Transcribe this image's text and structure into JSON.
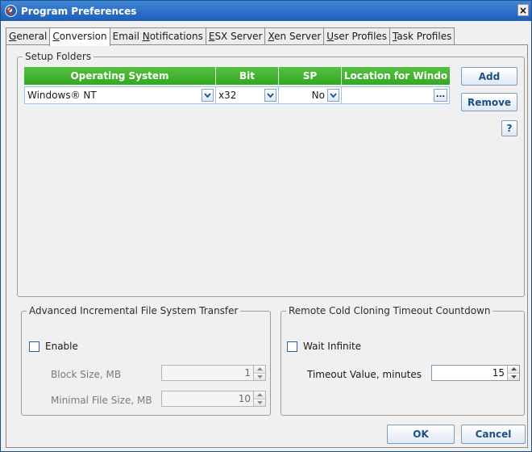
{
  "window": {
    "title": "Program Preferences",
    "close_glyph": "×"
  },
  "tabs": [
    {
      "pre": "",
      "u": "G",
      "post": "eneral",
      "active": false
    },
    {
      "pre": "",
      "u": "C",
      "post": "onversion",
      "active": true
    },
    {
      "pre": "Email ",
      "u": "N",
      "post": "otifications",
      "active": false
    },
    {
      "pre": "",
      "u": "E",
      "post": "SX Server",
      "active": false
    },
    {
      "pre": "",
      "u": "X",
      "post": "en Server",
      "active": false
    },
    {
      "pre": "",
      "u": "U",
      "post": "ser Profiles",
      "active": false
    },
    {
      "pre": "",
      "u": "T",
      "post": "ask Profiles",
      "active": false
    }
  ],
  "setup_folders": {
    "title": "Setup Folders",
    "columns": [
      "Operating System",
      "Bit",
      "SP",
      "Location for Windo"
    ],
    "rows": [
      {
        "os": "Windows® NT",
        "bit": "x32",
        "sp": "No",
        "location": ""
      }
    ],
    "browse_label": "...",
    "add_label": "Add",
    "remove_label": "Remove",
    "help_label": "?"
  },
  "advanced_transfer": {
    "title": "Advanced Incremental File System Transfer",
    "enable_label": "Enable",
    "block_size_label": "Block Size, MB",
    "block_size_value": "1",
    "min_file_size_label": "Minimal File Size, MB",
    "min_file_size_value": "10"
  },
  "remote_cold_cloning": {
    "title": "Remote Cold Cloning Timeout Countdown",
    "wait_infinite_label": "Wait Infinite",
    "timeout_label": "Timeout Value, minutes",
    "timeout_value": "15"
  },
  "footer": {
    "ok_label": "OK",
    "cancel_label": "Cancel"
  },
  "colors": {
    "header_green": "#3fb22c",
    "accent_blue": "#1f5eb5"
  }
}
